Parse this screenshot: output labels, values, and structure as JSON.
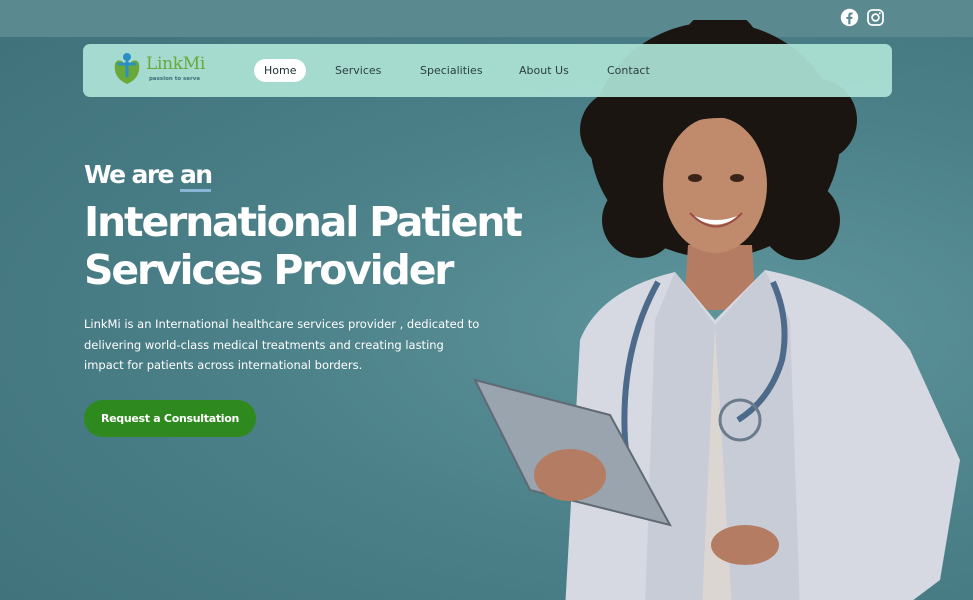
{
  "social": {
    "facebook_icon": "facebook-icon",
    "instagram_icon": "instagram-icon"
  },
  "brand": {
    "name": "LinkMi",
    "tagline": "passion to serve",
    "logo_icon": "person-heart-icon",
    "color": "#6aa83a"
  },
  "nav": {
    "items": [
      {
        "label": "Home",
        "active": true
      },
      {
        "label": "Services",
        "active": false
      },
      {
        "label": "Specialities",
        "active": false
      },
      {
        "label": "About Us",
        "active": false
      },
      {
        "label": "Contact",
        "active": false
      }
    ]
  },
  "hero": {
    "subtitle_prefix": "We are",
    "subtitle_highlight": "an",
    "title_line1": "International Patient",
    "title_line2": "Services Provider",
    "description": "LinkMi is an International healthcare services provider , dedicated to delivering world-class medical treatments and creating lasting impact for patients across international borders.",
    "cta_label": "Request a Consultation",
    "cta_color": "#2e8a1e",
    "image_icon": "doctor-with-tablet-photo"
  }
}
